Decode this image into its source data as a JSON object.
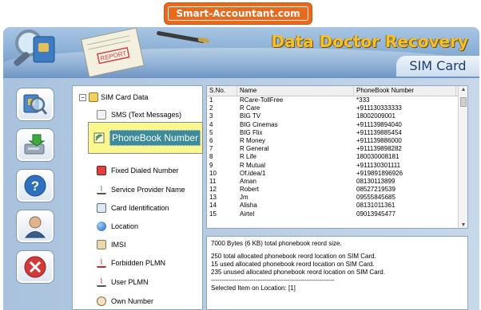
{
  "badge": {
    "text": "Smart-Accountant.com"
  },
  "header": {
    "title": "Data Doctor Recovery",
    "subtitle": "SIM Card",
    "art_report_label": "REPORT"
  },
  "toolbar": {
    "buttons": [
      {
        "icon": "sim-search-icon"
      },
      {
        "icon": "save-drive-icon"
      },
      {
        "icon": "help-icon"
      },
      {
        "icon": "user-support-icon"
      },
      {
        "icon": "exit-icon"
      }
    ]
  },
  "tree": {
    "root_expander": "−",
    "root_label": "SIM Card Data",
    "items": [
      {
        "label": "SMS (Text Messages)",
        "icon": "sms-icon"
      },
      {
        "label": "PhoneBook Number",
        "icon": "phonebook-icon",
        "selected": true
      },
      {
        "label": "Fixed Dialed Number",
        "icon": "fixed-dial-icon"
      },
      {
        "label": "Service Provider Name",
        "icon": "antenna-icon"
      },
      {
        "label": "Card Identification",
        "icon": "card-id-icon"
      },
      {
        "label": "Location",
        "icon": "globe-icon"
      },
      {
        "label": "IMSI",
        "icon": "imsi-icon"
      },
      {
        "label": "Forbidden PLMN",
        "icon": "antenna-red-icon"
      },
      {
        "label": "User PLMN",
        "icon": "antenna-icon"
      },
      {
        "label": "Own Number",
        "icon": "own-number-icon"
      }
    ]
  },
  "grid": {
    "columns": [
      "S.No.",
      "Name",
      "PhoneBook Number"
    ],
    "rows": [
      [
        "1",
        "RCare-TollFree",
        "*333"
      ],
      [
        "2",
        "R Care",
        "+911130333333"
      ],
      [
        "3",
        "BIG TV",
        "18002009001"
      ],
      [
        "4",
        "BIG Cinemas",
        "+911139894040"
      ],
      [
        "5",
        "BIG Flix",
        "+911139885454"
      ],
      [
        "6",
        "R Money",
        "+911139886000"
      ],
      [
        "7",
        "R General",
        "+911139898282"
      ],
      [
        "8",
        "R Life",
        "180030008181"
      ],
      [
        "9",
        "R Mutual",
        "+911130301111"
      ],
      [
        "10",
        "Of.idea/1",
        "+919891896926"
      ],
      [
        "11",
        "Aman",
        "08130113899"
      ],
      [
        "12",
        "Robert",
        "08527219539"
      ],
      [
        "13",
        "Jm",
        "09555845685"
      ],
      [
        "14",
        "Alisha",
        "08131011361"
      ],
      [
        "15",
        "Airtel",
        "09013945477"
      ]
    ]
  },
  "info": {
    "lines": [
      "7000 Bytes (6 KB) total phonebook reord size.",
      "",
      "250 total allocated phonebook reord location on SIM Card.",
      "15 used allocated phonebook reord location on SIM Card.",
      "235 unused allocated phonebook reord location on SIM Card.",
      "----------------------------------------------------------",
      "Selected Item on Location: [1]"
    ]
  }
}
